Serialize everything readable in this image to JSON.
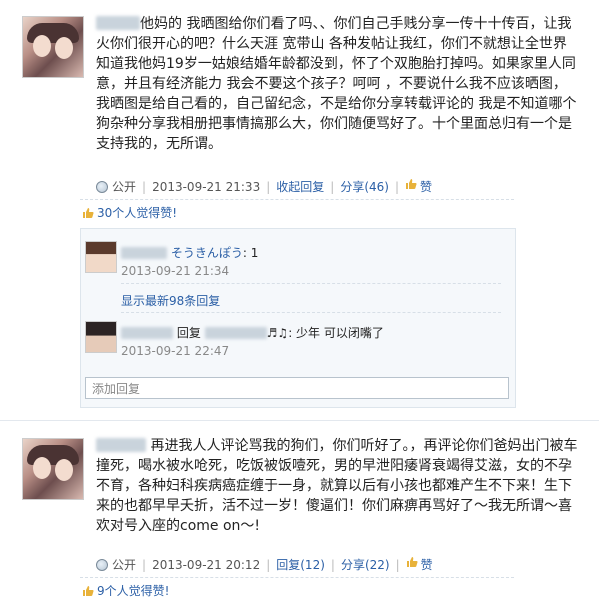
{
  "posts": [
    {
      "author_visible": "他妈的",
      "text_line1": " 我晒图给你们看了吗、、你们自己手贱分享一传十十传",
      "text_rest": "百，让我火你们很开心的吧？什么天涯 宽带山 各种发帖让我红，你们不就想让全世界知道我他妈19岁一姑娘结婚年龄都没到，怀了个双胞胎打掉吗。如果家里人同意，并且有经济能力 我会不要这个孩子？呵呵 ，不要说什么我不应该晒图，我晒图是给自己看的，自己留纪念，不是给你分享转载评论的 我是不知道哪个狗杂种分享我相册把事情搞那么大，你们随便骂好了。十个里面总归有一个是支持我的，无所谓。",
      "visibility": "公开",
      "timestamp": "2013-09-21 21:33",
      "collapse_label": "收起回复",
      "share_label": "分享(46)",
      "like_label": "赞",
      "likes_text": "30个人觉得赞!",
      "replies": [
        {
          "name_suffix": "そうきんぽう",
          "text": ": 1",
          "time": "2013-09-21 21:34"
        },
        {
          "prefix": "回复",
          "text": "♬♫: 少年  可以闭嘴了",
          "time": "2013-09-21 22:47"
        }
      ],
      "show_more": "显示最新98条回复",
      "add_reply_placeholder": "添加回复"
    },
    {
      "text_line1": "再进我人人评论骂我的狗们，你们听好了。，再评论你们爸妈出",
      "text_rest": "门被车撞死，喝水被水呛死，吃饭被饭噎死，男的早泄阳痿肾衰竭得艾滋，女的不孕不育，各种妇科疾病癌症缠于一身，就算以后有小孩也都难产生不下来！生下来的也都早早夭折，活不过一岁！傻逼们！你们麻痹再骂好了～我无所谓～喜欢对号入座的come on～!",
      "visibility": "公开",
      "timestamp": "2013-09-21 20:12",
      "collapse_label": "回复(12)",
      "share_label": "分享(22)",
      "like_label": "赞",
      "likes_text": "9个人觉得赞!"
    }
  ],
  "colors": {
    "link": "#2b5fa6",
    "reply_bg": "#f5f8fb",
    "meta": "#555555"
  }
}
